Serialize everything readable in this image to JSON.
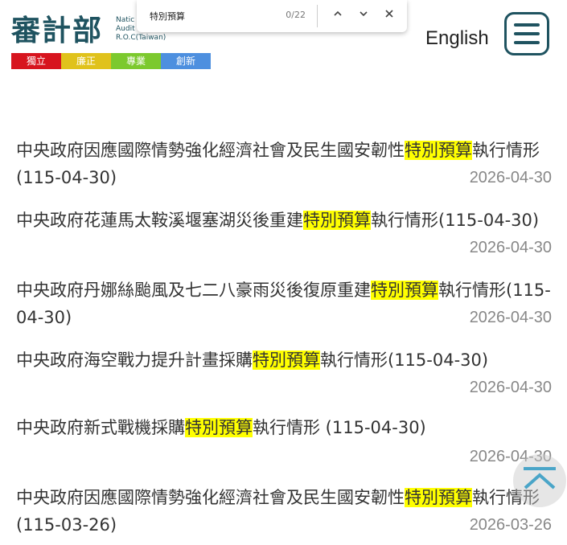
{
  "header": {
    "logo_text": "審計部",
    "logo_sub": [
      "Natic",
      "Audit",
      "R.O.C(Taiwan)"
    ],
    "tags": [
      {
        "label": "獨立",
        "color": "#d7141e"
      },
      {
        "label": "廉正",
        "color": "#e0c21b"
      },
      {
        "label": "專業",
        "color": "#7cc92e"
      },
      {
        "label": "創新",
        "color": "#4d8fdf"
      }
    ],
    "language": "English"
  },
  "findbar": {
    "query": "特別預算",
    "count": "0/22"
  },
  "items": [
    {
      "pre": "中央政府因應國際情勢強化經濟社會及民生國安韌性",
      "hl": "特別預算",
      "post": "執行情形(115-04-30)",
      "date": "2026-04-30"
    },
    {
      "pre": "中央政府花蓮馬太鞍溪堰塞湖災後重建",
      "hl": "特別預算",
      "post": "執行情形(115-04-30)",
      "date": "2026-04-30"
    },
    {
      "pre": "中央政府丹娜絲颱風及七二八豪雨災後復原重建",
      "hl": "特別預算",
      "post": "執行情形(115-04-30)",
      "date": "2026-04-30"
    },
    {
      "pre": "中央政府海空戰力提升計畫採購",
      "hl": "特別預算",
      "post": "執行情形(115-04-30)",
      "date": "2026-04-30"
    },
    {
      "pre": "中央政府新式戰機採購",
      "hl": "特別預算",
      "post": "執行情形 (115-04-30)",
      "date": "2026-04-30"
    },
    {
      "pre": "中央政府因應國際情勢強化經濟社會及民生國安韌性",
      "hl": "特別預算",
      "post": "執行情形(115-03-26)",
      "date": "2026-03-26"
    }
  ]
}
